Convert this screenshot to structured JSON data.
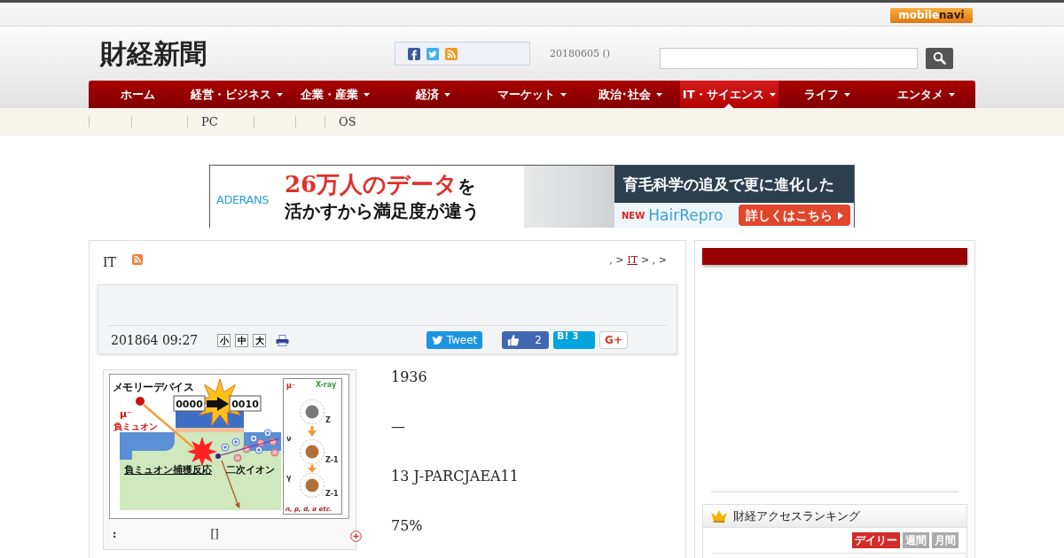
{
  "top_bar": {
    "logo_left": "mobile",
    "logo_right": "navi"
  },
  "header": {
    "site_title": "財経新聞",
    "date": "20180605 ()"
  },
  "nav": {
    "items": [
      {
        "label": "ホーム",
        "dropdown": false,
        "selected": false
      },
      {
        "label": "経営・ビジネス",
        "dropdown": true,
        "selected": false
      },
      {
        "label": "企業・産業",
        "dropdown": true,
        "selected": false
      },
      {
        "label": "経済",
        "dropdown": true,
        "selected": false
      },
      {
        "label": "マーケット",
        "dropdown": true,
        "selected": false
      },
      {
        "label": "政治･社会",
        "dropdown": true,
        "selected": false
      },
      {
        "label": "IT・サイエンス",
        "dropdown": true,
        "selected": true
      },
      {
        "label": "ライフ",
        "dropdown": true,
        "selected": false
      },
      {
        "label": "エンタメ",
        "dropdown": true,
        "selected": false
      }
    ]
  },
  "subnav": {
    "items": [
      "PC",
      "OS"
    ]
  },
  "ad": {
    "brand": "ADERANS",
    "headline": "26万人のデータ",
    "headline_tail": "を",
    "subline": "活かすから満足度が違う",
    "panel_text": "育毛科学の追及で更に進化した",
    "new_badge": "NEW",
    "product": "HairRepro",
    "cta": "詳しくはこちら"
  },
  "article": {
    "category": "IT",
    "breadcrumb": [
      {
        "kind": "text",
        "text": ", >"
      },
      {
        "kind": "link",
        "text": "IT"
      },
      {
        "kind": "text",
        "text": "> , >"
      }
    ],
    "date": "201864 09:27",
    "font_sizes": [
      "小",
      "中",
      "大"
    ],
    "share": {
      "tweet": "Tweet",
      "like_count": "2",
      "bookmark_label": "B!",
      "bookmark_count": "3",
      "plus_label": "G+"
    },
    "figure": {
      "diagram": {
        "device": "メモリーデバイス",
        "bit_before": "0000",
        "bit_after": "0010",
        "particle": "μ⁻",
        "particle_name": "負ミュオン",
        "reaction": "負ミュオン捕獲反応",
        "ion": "二次イオン",
        "inset_top": [
          "μ⁻",
          "X-ray"
        ],
        "atom_labels": [
          "Z",
          "Z-1",
          "Z-1"
        ],
        "inset_side": [
          "ν",
          "γ"
        ],
        "inset_bottom": "n, p, d, α etc."
      },
      "caption": ":",
      "caption_link": "[]"
    },
    "paragraphs": [
      "1936",
      "—",
      "13 J-PARCJAEA11",
      "75%"
    ]
  },
  "sidebar": {
    "ranking": {
      "title": "財経アクセスランキング",
      "tabs": [
        {
          "label": "デイリー",
          "selected": true
        },
        {
          "label": "週間",
          "selected": false
        },
        {
          "label": "月間",
          "selected": false
        }
      ]
    }
  }
}
